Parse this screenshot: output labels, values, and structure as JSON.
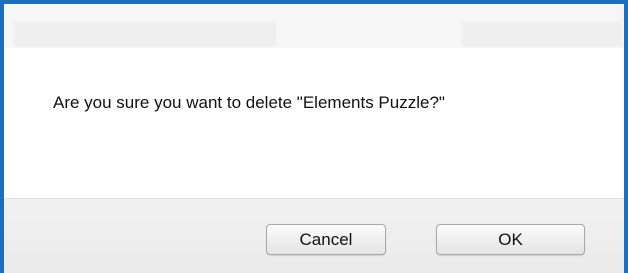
{
  "dialog": {
    "message": "Are you sure you want to delete \"Elements Puzzle?\"",
    "cancel_label": "Cancel",
    "ok_label": "OK"
  },
  "colors": {
    "frame_border": "#1b6fc1",
    "footer_background": "#ebebeb",
    "button_border": "#a9a9a9"
  }
}
